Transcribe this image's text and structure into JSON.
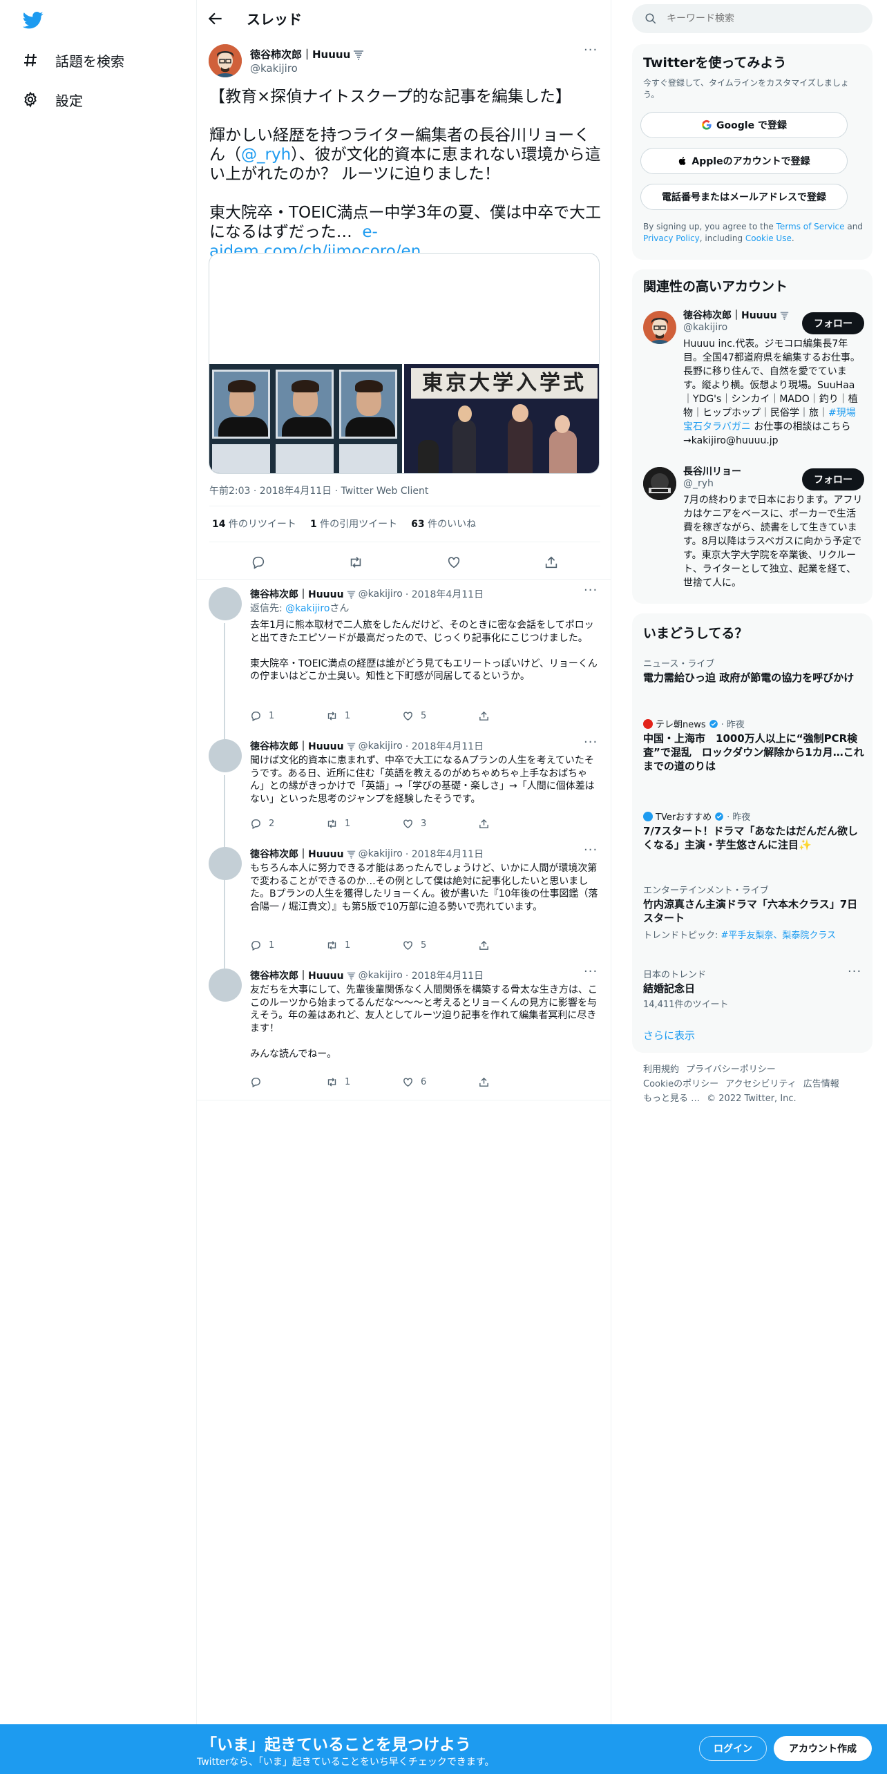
{
  "nav": {
    "explore_label": "話題を検索",
    "settings_label": "設定"
  },
  "header": {
    "title": "スレッド"
  },
  "main_tweet": {
    "name": "徳谷柿次郎｜Huuuu",
    "handle": "@kakijiro",
    "text_part1": "【教育×探偵ナイトスクープ的な記事を編集した】\n\n輝かしい経歴を持つライター編集者の長谷川リョーくん（",
    "mention": "@_ryh",
    "text_part2": "）、彼が文化的資本に恵まれない環境から這い上がれたのか？ ルーツに迫りました！\n\n東大院卒・TOEIC満点ー中学3年の夏、僕は中卒で大工になるはずだった…  ",
    "link": "e-aidem.com/ch/jimocoro/en…",
    "photo_banner": "東京大学入学式",
    "meta": "午前2:03 · 2018年4月11日 · Twitter Web Client",
    "retweets_num": "14",
    "retweets_label": " 件のリツイート",
    "quotes_num": "1",
    "quotes_label": " 件の引用ツイート",
    "likes_num": "63",
    "likes_label": " 件のいいね"
  },
  "replies": [
    {
      "name": "徳谷柿次郎｜Huuuu",
      "handle": "@kakijiro",
      "date": "· 2018年4月11日",
      "reply_to_prefix": "返信先: ",
      "reply_to_handle": "@kakijiro",
      "reply_to_suffix": "さん",
      "text": "去年1月に熊本取材で二人旅をしたんだけど、そのときに密な会話をしてポロッと出てきたエピソードが最高だったので、じっくり記事化にこじつけました。\n\n東大院卒・TOEIC満点の経歴は誰がどう見てもエリートっぽいけど、リョーくんの佇まいはどこか土臭い。知性と下町感が同居してるというか。",
      "reply_count": "1",
      "retweet_count": "1",
      "like_count": "5"
    },
    {
      "name": "徳谷柿次郎｜Huuuu",
      "handle": "@kakijiro",
      "date": "· 2018年4月11日",
      "text": "聞けば文化的資本に恵まれず、中卒で大工になるAプランの人生を考えていたそうです。ある日、近所に住む「英語を教えるのがめちゃめちゃ上手なおばちゃん」との縁がきっかけで「英語」→「学びの基礎・楽しさ」→「人間に個体差はない」といった思考のジャンプを経験したそうです。",
      "reply_count": "2",
      "retweet_count": "1",
      "like_count": "3"
    },
    {
      "name": "徳谷柿次郎｜Huuuu",
      "handle": "@kakijiro",
      "date": "· 2018年4月11日",
      "text": "もちろん本人に努力できる才能はあったんでしょうけど、いかに人間が環境次第で変わることができるのか…その例として僕は絶対に記事化したいと思いました。Bプランの人生を獲得したリョーくん。彼が書いた『10年後の仕事図鑑（落合陽一 / 堀江貴文）』も第5版で10万部に迫る勢いで売れています。",
      "reply_count": "1",
      "retweet_count": "1",
      "like_count": "5"
    },
    {
      "name": "徳谷柿次郎｜Huuuu",
      "handle": "@kakijiro",
      "date": "· 2018年4月11日",
      "text": "友だちを大事にして、先輩後輩関係なく人間関係を構築する骨太な生き方は、ここのルーツから始まってるんだな〜〜〜と考えるとリョーくんの見方に影響を与えそう。年の差はあれど、友人としてルーツ迫り記事を作れて編集者冥利に尽きます！\n\nみんな読んでねー。",
      "reply_count": "",
      "retweet_count": "1",
      "like_count": "6"
    }
  ],
  "right": {
    "search_placeholder": "キーワード検索",
    "signup_card": {
      "title": "Twitterを使ってみよう",
      "subtitle": "今すぐ登録して、タイムラインをカスタマイズしましょう。",
      "google_label": "Google で登録",
      "apple_label": "Appleのアカウントで登録",
      "phone_label": "電話番号またはメールアドレスで登録",
      "terms_prefix": "By signing up, you agree to the ",
      "terms_link": "Terms of Service",
      "terms_and": " and ",
      "privacy_link": "Privacy Policy",
      "terms_including": ", including ",
      "cookie_link": "Cookie Use",
      "terms_end": "."
    },
    "relevant": {
      "title": "関連性の高いアカウント",
      "follow_label": "フォロー",
      "accounts": [
        {
          "name": "徳谷柿次郎｜Huuuu",
          "handle": "@kakijiro",
          "bio_main": "Huuuu inc.代表。ジモコロ編集長7年目。全国47都道府県を編集するお仕事。長野に移り住んで、自然を愛でています。縦より横。仮想より現場。SuuHaa｜YDG's｜シンカイ｜MADO｜釣り｜植物｜ヒップホップ｜民俗学｜旅｜",
          "bio_tag": "#現場宝石タラバガニ",
          "bio_end": " お仕事の相談はこちら→kakijiro@huuuu.jp"
        },
        {
          "name": "長谷川リョー",
          "handle": "@_ryh",
          "bio_main": "7月の終わりまで日本におります。アフリカはケニアをベースに、ポーカーで生活費を稼ぎながら、読書をして生きています。8月以降はラスベガスに向かう予定です。東京大学大学院を卒業後、リクルート、ライターとして独立、起業を経て、世捨て人に。",
          "bio_tag": "",
          "bio_end": ""
        }
      ]
    },
    "trends": {
      "title": "いまどうしてる？",
      "items": [
        {
          "context": "ニュース・ライブ",
          "title": "電力需給ひっ迫 政府が節電の協力を呼びかけ"
        },
        {
          "context_source": "テレ朝news",
          "context_time": "· 昨夜",
          "title": "中国・上海市　1000万人以上に“強制PCR検査”で混乱　ロックダウン解除から1カ月…これまでの道のりは"
        },
        {
          "context_source": "TVerおすすめ",
          "context_time": "· 昨夜",
          "title": "7/7スタート！ドラマ「あなたはだんだん欲しくなる」主演・芋生悠さんに注目✨"
        },
        {
          "context": "エンターテインメント・ライブ",
          "title": "竹内涼真さん主演ドラマ「六本木クラス」7日スタート",
          "sub_prefix": "トレンドトピック: ",
          "sub_tag": "#平手友梨奈、梨泰院クラス"
        },
        {
          "context": "日本のトレンド",
          "title": "結婚記念日",
          "sub": "14,411件のツイート"
        }
      ],
      "show_more": "さらに表示"
    },
    "footer": {
      "links": [
        "利用規約",
        "プライバシーポリシー",
        "Cookieのポリシー",
        "アクセシビリティ",
        "広告情報",
        "もっと見る …"
      ],
      "copyright": "© 2022 Twitter, Inc."
    }
  },
  "bottom_bar": {
    "title": "「いま」起きていることを見つけよう",
    "subtitle": "Twitterなら、「いま」起きていることをいち早くチェックできます。",
    "login_label": "ログイン",
    "signup_label": "アカウント作成"
  },
  "colors": {
    "accent": "#1d9bf0",
    "text": "#0f1419",
    "muted": "#536471",
    "border": "#eff3f4"
  }
}
